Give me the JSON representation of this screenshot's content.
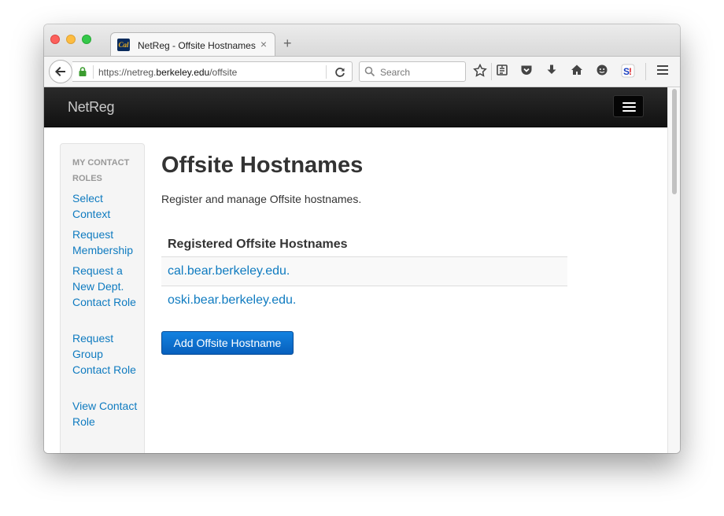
{
  "browser": {
    "tab_title": "NetReg - Offsite Hostnames",
    "tab_favicon_text": "Cal",
    "tab_close": "×",
    "new_tab": "+",
    "url_prefix": "https://netreg.",
    "url_domain": "berkeley.edu",
    "url_path": "/offsite",
    "search_placeholder": "Search",
    "icons": [
      "back-arrow-icon",
      "lock-icon",
      "reload-icon",
      "search-icon",
      "bookmark-star-icon",
      "reading-list-icon",
      "pocket-icon",
      "download-icon",
      "home-icon",
      "chat-icon",
      "extension-icon",
      "menu-icon"
    ]
  },
  "site": {
    "brand": "NetReg"
  },
  "sidebar": {
    "heading": "MY CONTACT ROLES",
    "items": [
      {
        "label": "Select Context"
      },
      {
        "label": "Request Membership"
      },
      {
        "label": "Request a New Dept. Contact Role"
      },
      {
        "label": "Request Group Contact Role"
      },
      {
        "label": "View Contact Role"
      }
    ]
  },
  "main": {
    "title": "Offsite Hostnames",
    "description": "Register and manage Offsite hostnames.",
    "table_header": "Registered Offsite Hostnames",
    "hostnames": [
      "cal.bear.berkeley.edu.",
      "oski.bear.berkeley.edu."
    ],
    "add_button": "Add Offsite Hostname"
  },
  "colors": {
    "link": "#0f7bc0",
    "primary_button": "#0a6fcf",
    "header_bg": "#1a1a1a"
  }
}
